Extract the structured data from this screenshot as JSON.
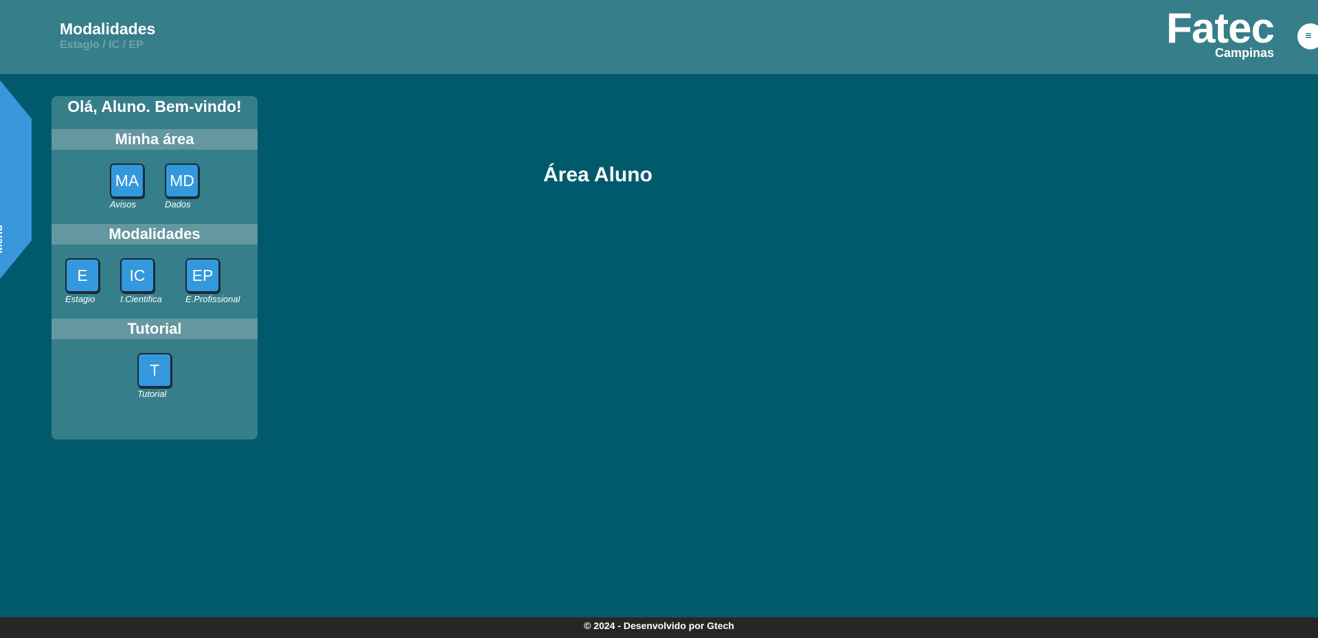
{
  "header": {
    "title": "Modalidades",
    "subtitle": "Estagio / IC / EP",
    "logo_main": "Fatec",
    "logo_sub": "Campinas",
    "menu_icon": "hamburger-icon",
    "menu_glyph": "≡"
  },
  "side_menu": {
    "label": "Menu"
  },
  "panel": {
    "greeting": "Olá, Aluno. Bem-vindo!",
    "sections": [
      {
        "title": "Minha área",
        "items": [
          {
            "abbr": "MA",
            "label": "Avisos"
          },
          {
            "abbr": "MD",
            "label": "Dados"
          }
        ]
      },
      {
        "title": "Modalidades",
        "items": [
          {
            "abbr": "E",
            "label": "Estagio"
          },
          {
            "abbr": "IC",
            "label": "I.Cientifica"
          },
          {
            "abbr": "EP",
            "label": "E.Profissional"
          }
        ]
      },
      {
        "title": "Tutorial",
        "items": [
          {
            "abbr": "T",
            "label": "Tutorial"
          }
        ]
      }
    ]
  },
  "main": {
    "heading": "Área Aluno"
  },
  "footer": {
    "text": "© 2024 - Desenvolvido por Gtech"
  },
  "colors": {
    "background": "#005a6c",
    "header": "#367e8a",
    "panel": "#367e8a",
    "section_bar": "#6597a0",
    "tile": "#3398dc",
    "menu_tab": "#3a97dc",
    "footer": "#262626"
  }
}
